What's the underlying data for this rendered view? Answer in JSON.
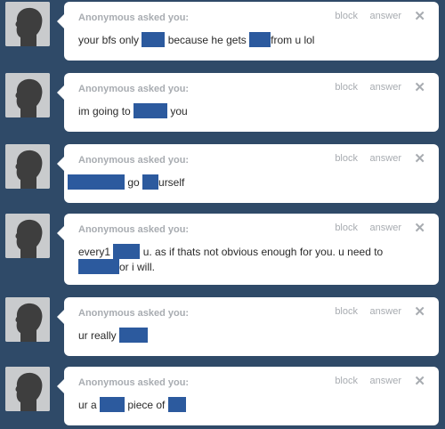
{
  "common": {
    "asker_label": "Anonymous asked you:",
    "block_label": "block",
    "answer_label": "answer",
    "close_glyph": "✕",
    "avatar_icon": "default-avatar-silhouette-icon",
    "redaction_color": "#2c5a9e"
  },
  "asks": [
    {
      "parts": [
        "your bfs only ",
        " because he gets ",
        "from u lol"
      ]
    },
    {
      "parts": [
        "im going to ",
        " you"
      ]
    },
    {
      "parts": [
        "",
        " go ",
        "urself"
      ]
    },
    {
      "parts": [
        "every1 ",
        " u. as if thats not obvious enough for you. u need to ",
        "or i will."
      ]
    },
    {
      "parts": [
        "ur really ",
        ""
      ]
    },
    {
      "parts": [
        "ur a ",
        " piece of ",
        ""
      ]
    }
  ]
}
